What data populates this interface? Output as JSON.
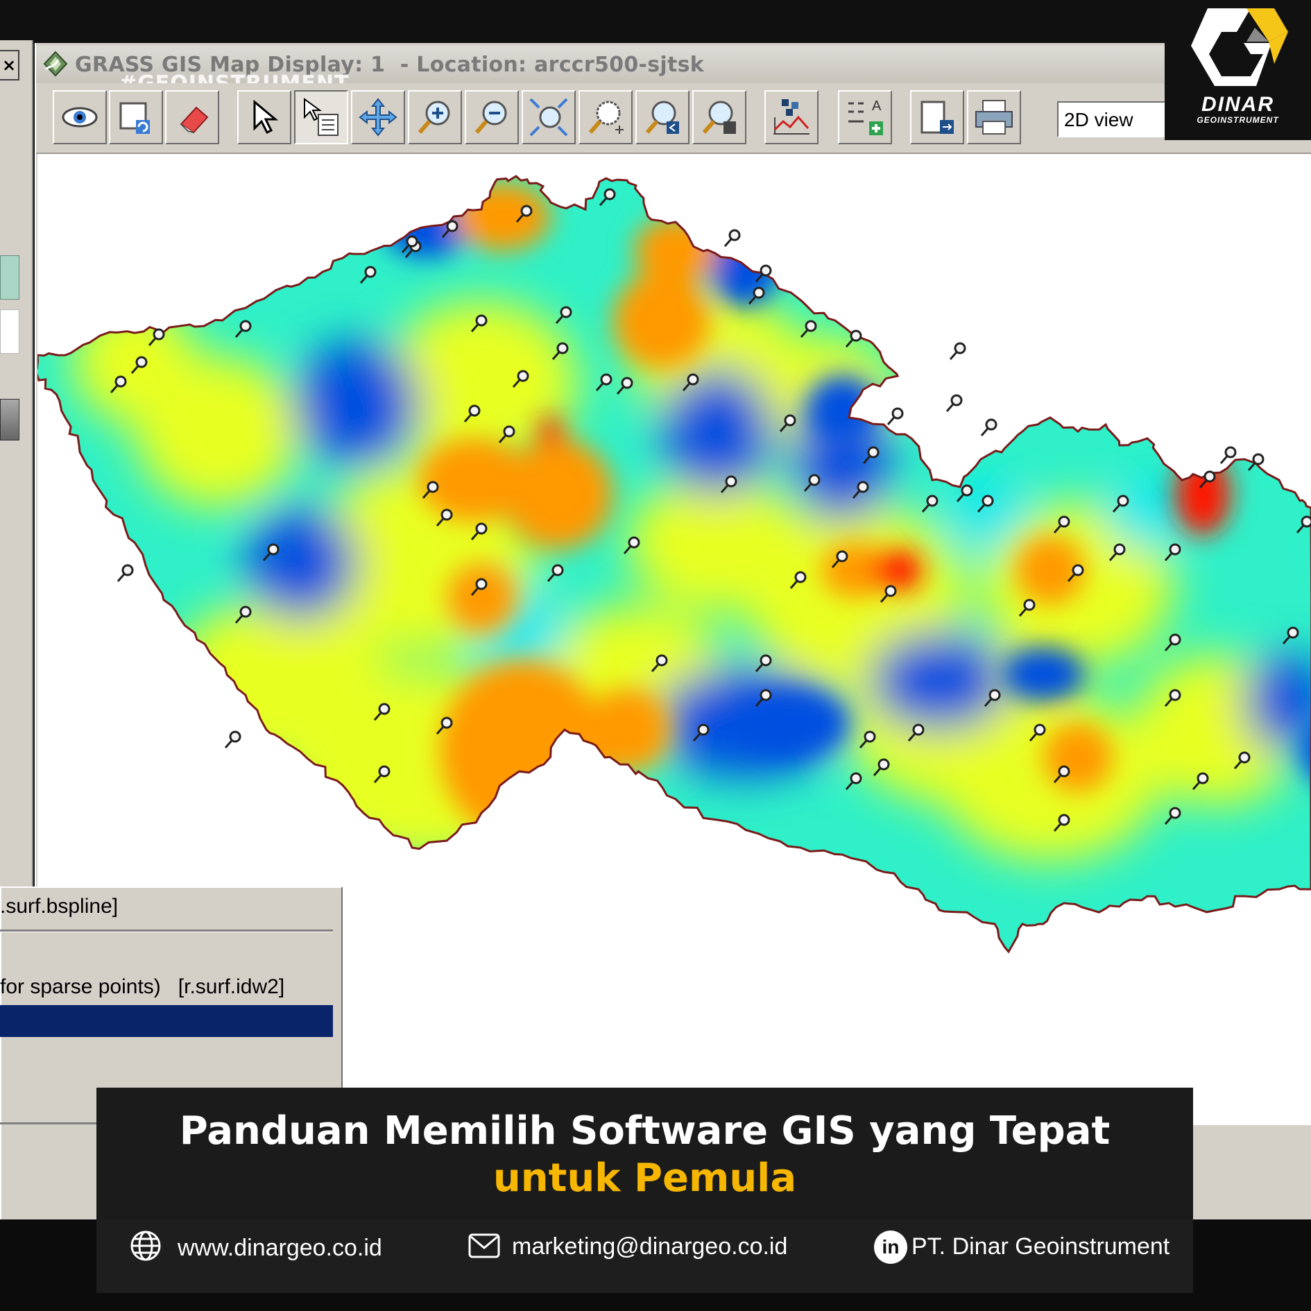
{
  "window": {
    "title": "GRASS GIS Map Display: 1  - Location: arccr500-sjtsk",
    "close_glyph": "×"
  },
  "watermark": "#GEOINSTRUMENT",
  "toolbar": {
    "tools": [
      "display-map",
      "redraw",
      "erase",
      "pointer",
      "query",
      "pan",
      "zoom-in",
      "zoom-out",
      "zoom-to-region",
      "zoom-region-box",
      "zoom-back",
      "zoom-menu",
      "analyze",
      "overlay-decorations",
      "save-display",
      "print"
    ],
    "view_mode": "2D view"
  },
  "dialog": {
    "module_1": ".surf.bspline]",
    "module_2": "for sparse points)   [r.surf.idw2]"
  },
  "logo": {
    "name": "DINAR",
    "subtitle": "GEOINSTRUMENT",
    "colors": {
      "accent": "#f5c518",
      "grey": "#8a8a8a",
      "white": "#ffffff"
    }
  },
  "headline": {
    "line1": "Panduan Memilih Software GIS yang Tepat",
    "line2": "untuk Pemula",
    "accent_color": "#f7b700"
  },
  "footer": {
    "website": "www.dinargeo.co.id",
    "email": "marketing@dinargeo.co.id",
    "linkedin": "PT. Dinar Geoinstrument",
    "linkedin_glyph": "in"
  },
  "map": {
    "legend_colors": [
      "#0050e0",
      "#00e8f0",
      "#e8ff20",
      "#ff9a00",
      "#ff1800"
    ]
  }
}
